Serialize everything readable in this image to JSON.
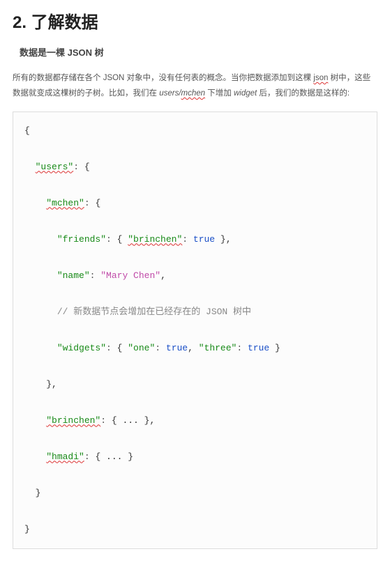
{
  "heading": "2. 了解数据",
  "subheading": "数据是一棵 JSON 树",
  "paragraph": {
    "pre": "所有的数据都存储在各个 JSON 对象中，没有任何表的概念。当你把数据添加到这棵 ",
    "json_word": "json",
    "mid1": " 树中，这些数据就变成这棵树的子树。比如，我们在 ",
    "path_users": "users/",
    "path_mchen": "mchen",
    "mid2": " 下增加 ",
    "widget_word": "widget",
    "tail": " 后，我们的数据是这样的:"
  },
  "code": {
    "k_users": "\"users\"",
    "k_mchen": "\"mchen\"",
    "k_friends": "\"friends\"",
    "k_brinchen": "\"brinchen\"",
    "k_name": "\"name\"",
    "v_name": "\"Mary Chen\"",
    "comment": "// 新数据节点会增加在已经存在的 JSON 树中",
    "k_widgets": "\"widgets\"",
    "k_one": "\"one\"",
    "k_three": "\"three\"",
    "k_brinchen2": "\"brinchen\"",
    "k_hmadi": "\"hmadi\"",
    "kw_true": "true",
    "ellipsis": "..."
  }
}
